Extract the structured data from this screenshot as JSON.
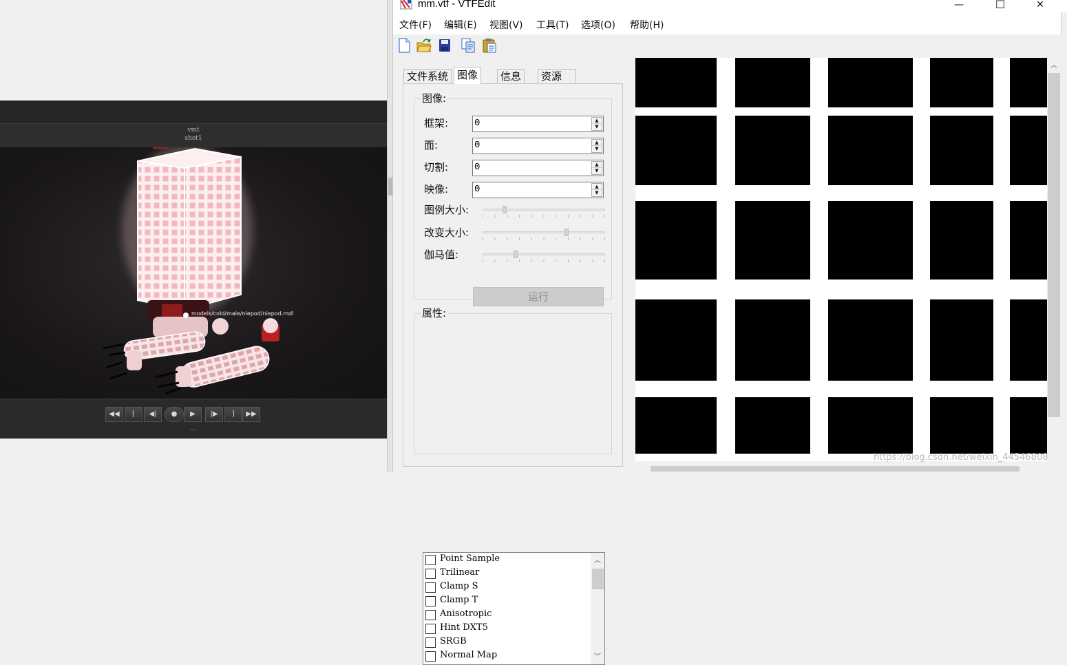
{
  "viewer": {
    "header_line1": "vmt",
    "header_line2": "shot1",
    "model_path": "models/cold/male/niepod/niepod.mdl",
    "transport": {
      "rewind": "◀◀",
      "mark_in": "[",
      "prev_frame": "◀|",
      "record": "●",
      "play": "▶",
      "next_frame": "|▶",
      "mark_out": "]",
      "fast_forward": "▶▶",
      "more": "..."
    }
  },
  "window": {
    "title": "mm.vtf - VTFEdit",
    "minimize": "—",
    "maximize": "☐",
    "close": "✕"
  },
  "menu": [
    "文件(F)",
    "编辑(E)",
    "视图(V)",
    "工具(T)",
    "选项(O)",
    "帮助(H)"
  ],
  "toolbar": [
    "new-icon",
    "open-icon",
    "save-icon",
    "copy-icon",
    "paste-icon"
  ],
  "tabs": [
    "文件系统",
    "图像",
    "信息",
    "资源"
  ],
  "image_group": {
    "title": "图像:",
    "frame_label": "框架:",
    "frame_value": "0",
    "face_label": "面:",
    "face_value": "0",
    "slice_label": "切割:",
    "slice_value": "0",
    "mipmap_label": "映像:",
    "mipmap_value": "0",
    "thumb_size_label": "图例大小:",
    "resize_label": "改变大小:",
    "gamma_label": "伽马值:",
    "thumb_size_level": 0.17,
    "resize_level": 0.69,
    "gamma_level": 0.26,
    "apply_label": "运行"
  },
  "properties": {
    "title": "属性:",
    "flags": [
      {
        "label": "Point Sample",
        "checked": false
      },
      {
        "label": "Trilinear",
        "checked": false
      },
      {
        "label": "Clamp S",
        "checked": false
      },
      {
        "label": "Clamp T",
        "checked": false
      },
      {
        "label": "Anisotropic",
        "checked": false
      },
      {
        "label": "Hint DXT5",
        "checked": false
      },
      {
        "label": "SRGB",
        "checked": false
      },
      {
        "label": "Normal Map",
        "checked": false
      }
    ]
  },
  "watermark": "https://blog.csdn.net/weixin_44546808",
  "colors": {
    "texture_black": "#000000",
    "texture_white": "#ffffff",
    "glow_pink": "#f6c9cd"
  }
}
